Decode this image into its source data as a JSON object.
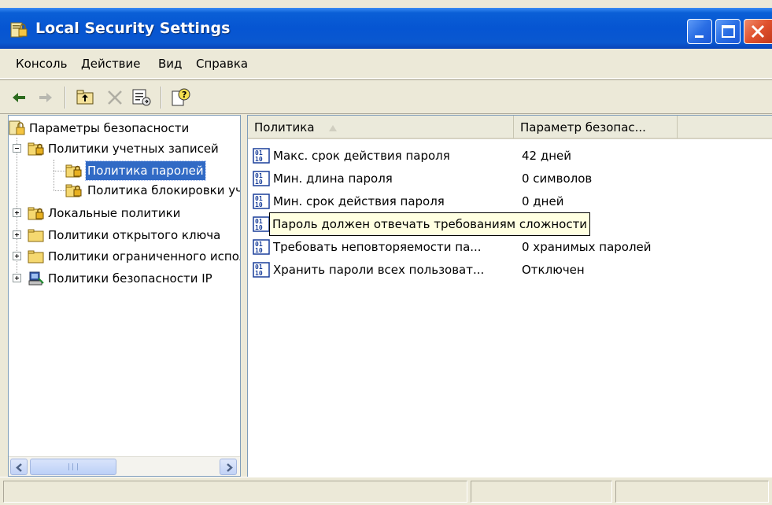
{
  "window": {
    "title": "Local Security Settings"
  },
  "menu": {
    "items": [
      {
        "label": "Консоль"
      },
      {
        "label": "Действие"
      },
      {
        "label": "Вид"
      },
      {
        "label": "Справка"
      }
    ]
  },
  "toolbar": {
    "buttons": [
      {
        "icon": "back-arrow-icon"
      },
      {
        "icon": "forward-arrow-icon"
      },
      {
        "icon": "up-folder-icon"
      },
      {
        "icon": "delete-x-icon"
      },
      {
        "icon": "export-list-icon"
      },
      {
        "icon": "help-icon"
      }
    ]
  },
  "tree": {
    "root": "Параметры безопасности",
    "items": [
      {
        "label": "Политики учетных записей",
        "expanded": true
      },
      {
        "label": "Политика паролей",
        "selected": true
      },
      {
        "label": "Политика блокировки учетной записи"
      },
      {
        "label": "Локальные политики"
      },
      {
        "label": "Политики открытого ключа"
      },
      {
        "label": "Политики ограниченного использования программ"
      },
      {
        "label": "Политики безопасности IP"
      }
    ]
  },
  "list": {
    "columns": [
      {
        "label": "Политика"
      },
      {
        "label": "Параметр безопас..."
      }
    ],
    "rows": [
      {
        "name": "Макс. срок действия пароля",
        "value": "42 дней"
      },
      {
        "name": "Мин. длина пароля",
        "value": "0 символов"
      },
      {
        "name": "Мин. срок действия пароля",
        "value": "0 дней"
      },
      {
        "name": "Пароль должен отвечать требованиям сложности",
        "value": ""
      },
      {
        "name": "Требовать неповторяемости па...",
        "value": "0 хранимых паролей"
      },
      {
        "name": "Хранить пароли всех пользоват...",
        "value": "Отключен"
      }
    ]
  },
  "colors": {
    "title_bar": "#0655d2",
    "selection": "#316ac5",
    "close_button": "#e0512e"
  }
}
